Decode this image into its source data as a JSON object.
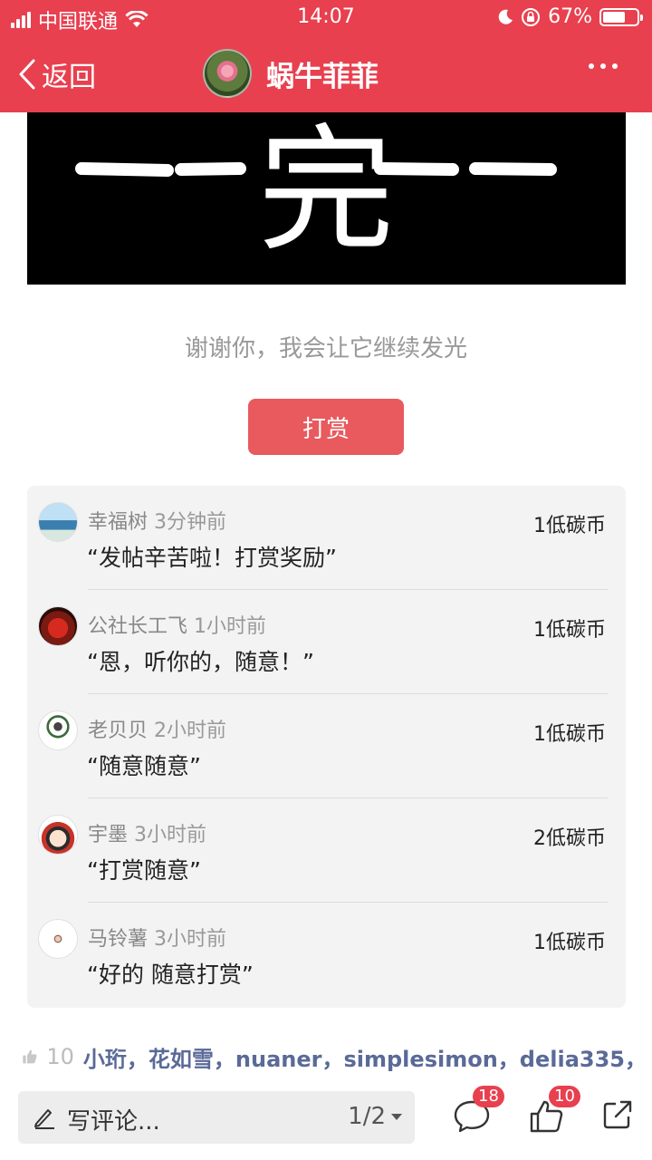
{
  "status_bar": {
    "carrier": "中国联通",
    "time": "14:07",
    "battery_percent": "67%",
    "battery_level": 0.67
  },
  "nav": {
    "back_label": "返回",
    "title": "蜗牛菲菲"
  },
  "end_image_text": "完",
  "thanks_text": "谢谢你，我会让它继续发光",
  "reward_button_label": "打赏",
  "rewards": [
    {
      "name": "幸福树",
      "time": "3分钟前",
      "comment": "“发帖辛苦啦！打赏奖励”",
      "amount": "1低碳币"
    },
    {
      "name": "公社长工飞",
      "time": "1小时前",
      "comment": "“恩，听你的，随意！”",
      "amount": "1低碳币"
    },
    {
      "name": "老贝贝",
      "time": "2小时前",
      "comment": "“随意随意”",
      "amount": "1低碳币"
    },
    {
      "name": "宇墨",
      "time": "3小时前",
      "comment": "“打赏随意”",
      "amount": "2低碳币"
    },
    {
      "name": "马铃薯",
      "time": "3小时前",
      "comment": "“好的 随意打赏”",
      "amount": "1低碳币"
    }
  ],
  "likes": {
    "count": "10",
    "names": "小珩，花如雪，nuaner，simplesimon，delia335，"
  },
  "bottom_bar": {
    "comment_placeholder": "写评论...",
    "pager": "1/2",
    "comment_badge": "18",
    "like_badge": "10"
  },
  "colors": {
    "brand_red": "#e8404f",
    "reward_button": "#e85a5d",
    "like_names": "#5a6a98"
  }
}
